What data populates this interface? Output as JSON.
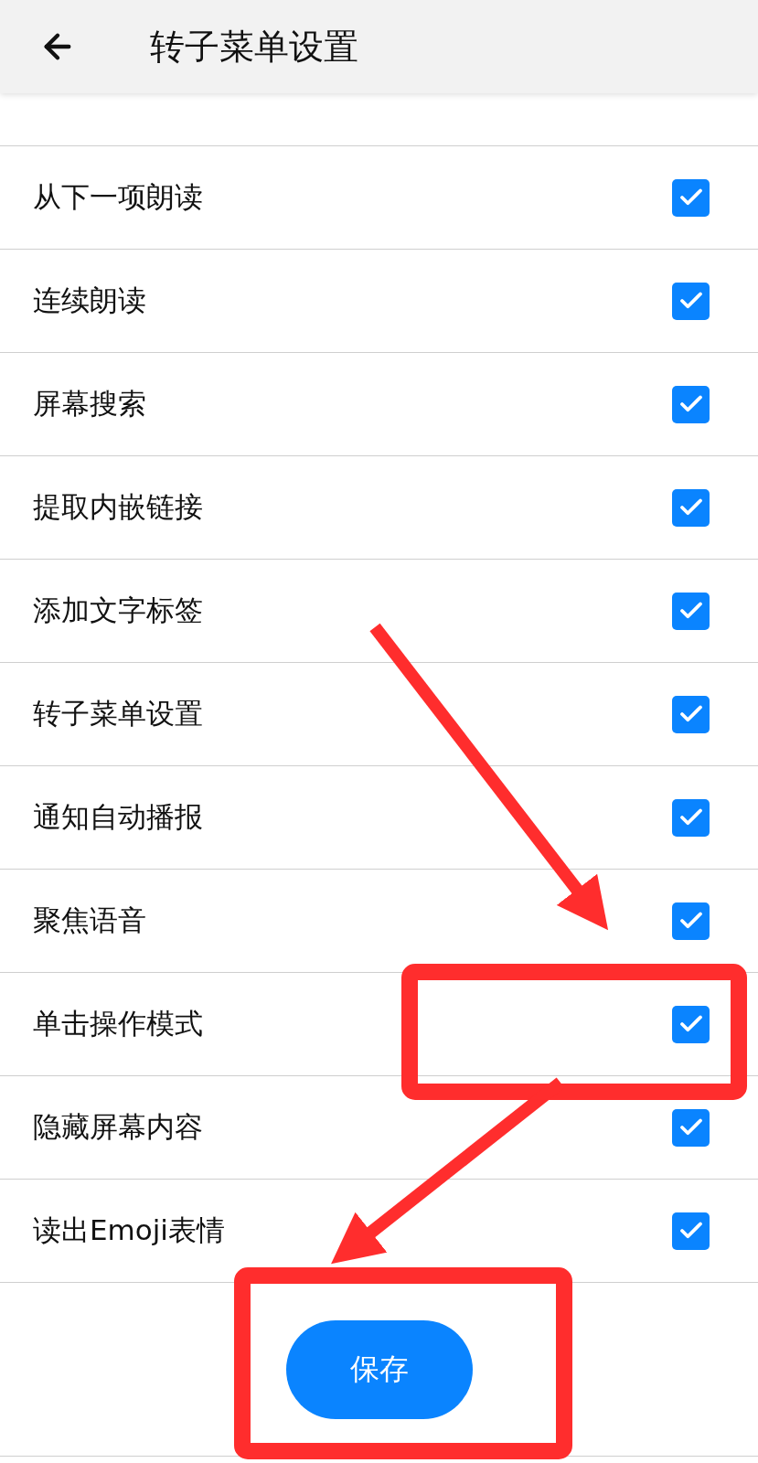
{
  "header": {
    "title": "转子菜单设置"
  },
  "items": [
    {
      "label": "从下一项朗读",
      "checked": true
    },
    {
      "label": "连续朗读",
      "checked": true
    },
    {
      "label": "屏幕搜索",
      "checked": true
    },
    {
      "label": "提取内嵌链接",
      "checked": true
    },
    {
      "label": "添加文字标签",
      "checked": true
    },
    {
      "label": "转子菜单设置",
      "checked": true
    },
    {
      "label": "通知自动播报",
      "checked": true
    },
    {
      "label": "聚焦语音",
      "checked": true
    },
    {
      "label": "单击操作模式",
      "checked": true
    },
    {
      "label": "隐藏屏幕内容",
      "checked": true
    },
    {
      "label": "读出Emoji表情",
      "checked": true
    }
  ],
  "save_button": {
    "label": "保存"
  }
}
